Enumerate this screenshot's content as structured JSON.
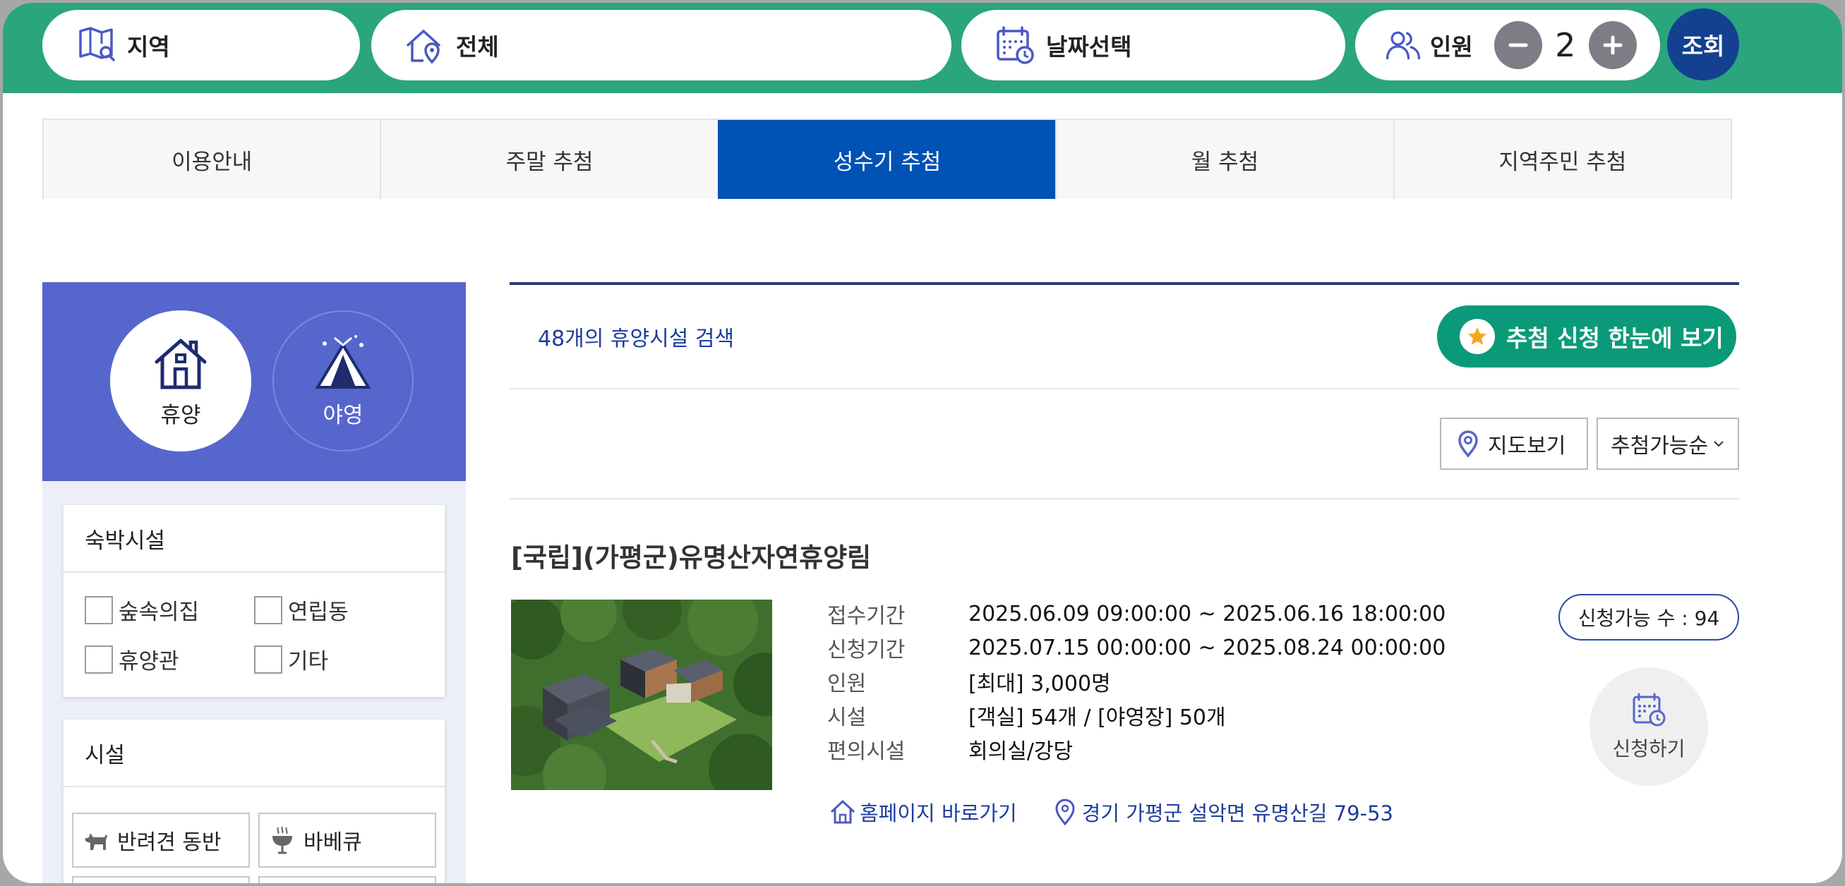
{
  "search_bar": {
    "region_label": "지역",
    "all_label": "전체",
    "date_label": "날짜선택",
    "people_label": "인원",
    "people_count": "2",
    "search_button": "조회"
  },
  "tabs": [
    {
      "label": "이용안내",
      "active": false
    },
    {
      "label": "주말 추첨",
      "active": false
    },
    {
      "label": "성수기 추첨",
      "active": true
    },
    {
      "label": "월 추첨",
      "active": false
    },
    {
      "label": "지역주민 추첨",
      "active": false
    }
  ],
  "sidebar": {
    "types": [
      {
        "label": "휴양",
        "icon": "house-icon",
        "selected": true
      },
      {
        "label": "야영",
        "icon": "tent-icon",
        "selected": false
      }
    ],
    "lodging": {
      "title": "숙박시설",
      "options": [
        "숲속의집",
        "연립동",
        "휴양관",
        "기타"
      ]
    },
    "facilities": {
      "title": "시설",
      "options": [
        {
          "label": "반려견 동반",
          "icon": "dog-icon"
        },
        {
          "label": "바베큐",
          "icon": "bbq-grill-icon"
        }
      ]
    }
  },
  "results": {
    "count_text": "48개의 휴양시설 검색",
    "lottery_button": "추첨 신청 한눈에 보기",
    "map_button": "지도보기",
    "sort_selected": "추첨가능순"
  },
  "item": {
    "title": "[국립](가평군)유명산자연휴양림",
    "details": [
      {
        "label": "접수기간",
        "value": "2025.06.09 09:00:00 ~ 2025.06.16 18:00:00"
      },
      {
        "label": "신청기간",
        "value": "2025.07.15 00:00:00 ~ 2025.08.24 00:00:00"
      },
      {
        "label": "인원",
        "value": "[최대] 3,000명"
      },
      {
        "label": "시설",
        "value": "[객실] 54개 / [야영장] 50개"
      },
      {
        "label": "편의시설",
        "value": "회의실/강당"
      }
    ],
    "homepage_link": "홈페이지 바로가기",
    "address": "경기 가평군 설악면 유명산길 79-53",
    "available_text": "신청가능 수 : 94",
    "apply_button": "신청하기"
  },
  "colors": {
    "topbar": "#2aa57e",
    "active_tab": "#0052b4",
    "sidebar_header": "#5766cd",
    "lottery_button": "#0b9a79",
    "search_button": "#13418f",
    "link_text": "#1b3d9e"
  }
}
